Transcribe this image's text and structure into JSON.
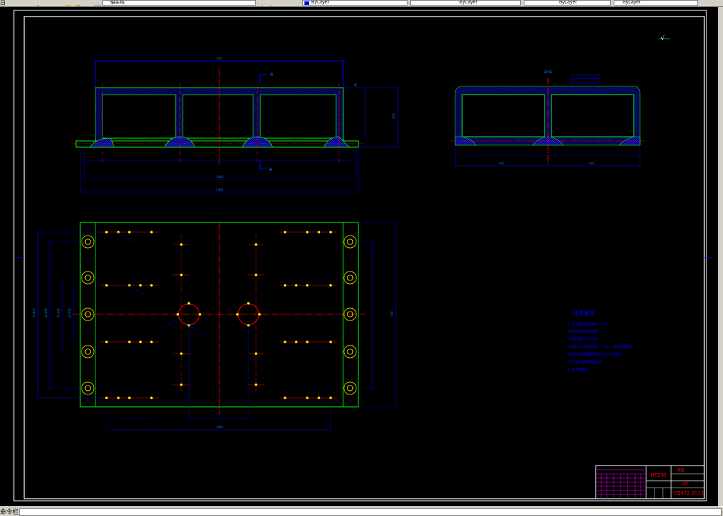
{
  "toolbar": {
    "corner_glyph": "日",
    "layer_name": "轴实线",
    "color_control": "ByLayer",
    "linetype_control": "ByLayer",
    "lineweight_control": "ByLayer",
    "plotstyle_control": "ByLayer"
  },
  "drawing": {
    "section_label_top": "A",
    "section_label_bottom": "A",
    "section_view_title": "A-A",
    "roughness_symbol": "√",
    "tech_req_title": "技术要求",
    "tech_req_items": [
      "1.未注铸造圆角R5~10;",
      "2.铸件需时效处理;",
      "3.铸件需人工时效;",
      "4.铸件不得有砂眼、气孔、裂纹等缺陷;",
      "5.精加工前需再次进行人工时效;",
      "6.不加工表面涂底漆;",
      "7.未注倒角1。"
    ],
    "title_block": {
      "material": "HT200",
      "part_name": "底座",
      "scale_label": "比例",
      "drawing_number": "YZJ472-2011"
    }
  },
  "statusbar": {
    "cmd_tab_label": "命令栏"
  },
  "colors": {
    "background": "#000000",
    "outline": "#00ff00",
    "dimension": "#0000ff",
    "centerline": "#ff0000",
    "hatch_fill": "#0000cc",
    "text_white": "#ffffff",
    "text_red": "#ff0000",
    "dim_text": "#0080ff"
  }
}
